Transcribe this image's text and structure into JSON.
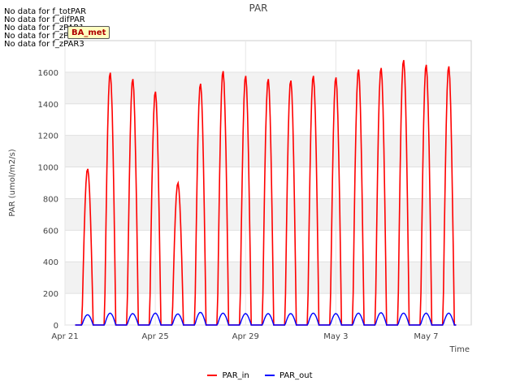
{
  "notes": [
    "No data for f_totPAR",
    "No data for f_difPAR",
    "No data for f_zPAR1",
    "No data for f_zPAR2",
    "No data for f_zPAR3"
  ],
  "badge": "BA_met",
  "chart_data": {
    "type": "line",
    "title": "PAR",
    "xlabel": "Time",
    "ylabel": "PAR (umol/m2/s)",
    "ylim": [
      0,
      1800
    ],
    "yticks": [
      0,
      200,
      400,
      600,
      800,
      1000,
      1200,
      1400,
      1600
    ],
    "xlim_day": [
      0,
      18
    ],
    "xticks": [
      {
        "day": 0,
        "label": "Apr 21"
      },
      {
        "day": 4,
        "label": "Apr 25"
      },
      {
        "day": 8,
        "label": "Apr 29"
      },
      {
        "day": 12,
        "label": "May 3"
      },
      {
        "day": 16,
        "label": "May 7"
      }
    ],
    "grid": true,
    "legend_position": "bottom",
    "series": [
      {
        "name": "PAR_in",
        "color": "#ff0000",
        "daily_peaks": [
          990,
          1600,
          1560,
          1480,
          900,
          1530,
          1610,
          1580,
          1560,
          1550,
          1580,
          1570,
          1620,
          1630,
          1680,
          1650,
          1640
        ]
      },
      {
        "name": "PAR_out",
        "color": "#0000ff",
        "daily_peaks": [
          65,
          75,
          72,
          75,
          70,
          80,
          75,
          72,
          72,
          72,
          75,
          72,
          75,
          78,
          75,
          75,
          75
        ]
      }
    ]
  }
}
